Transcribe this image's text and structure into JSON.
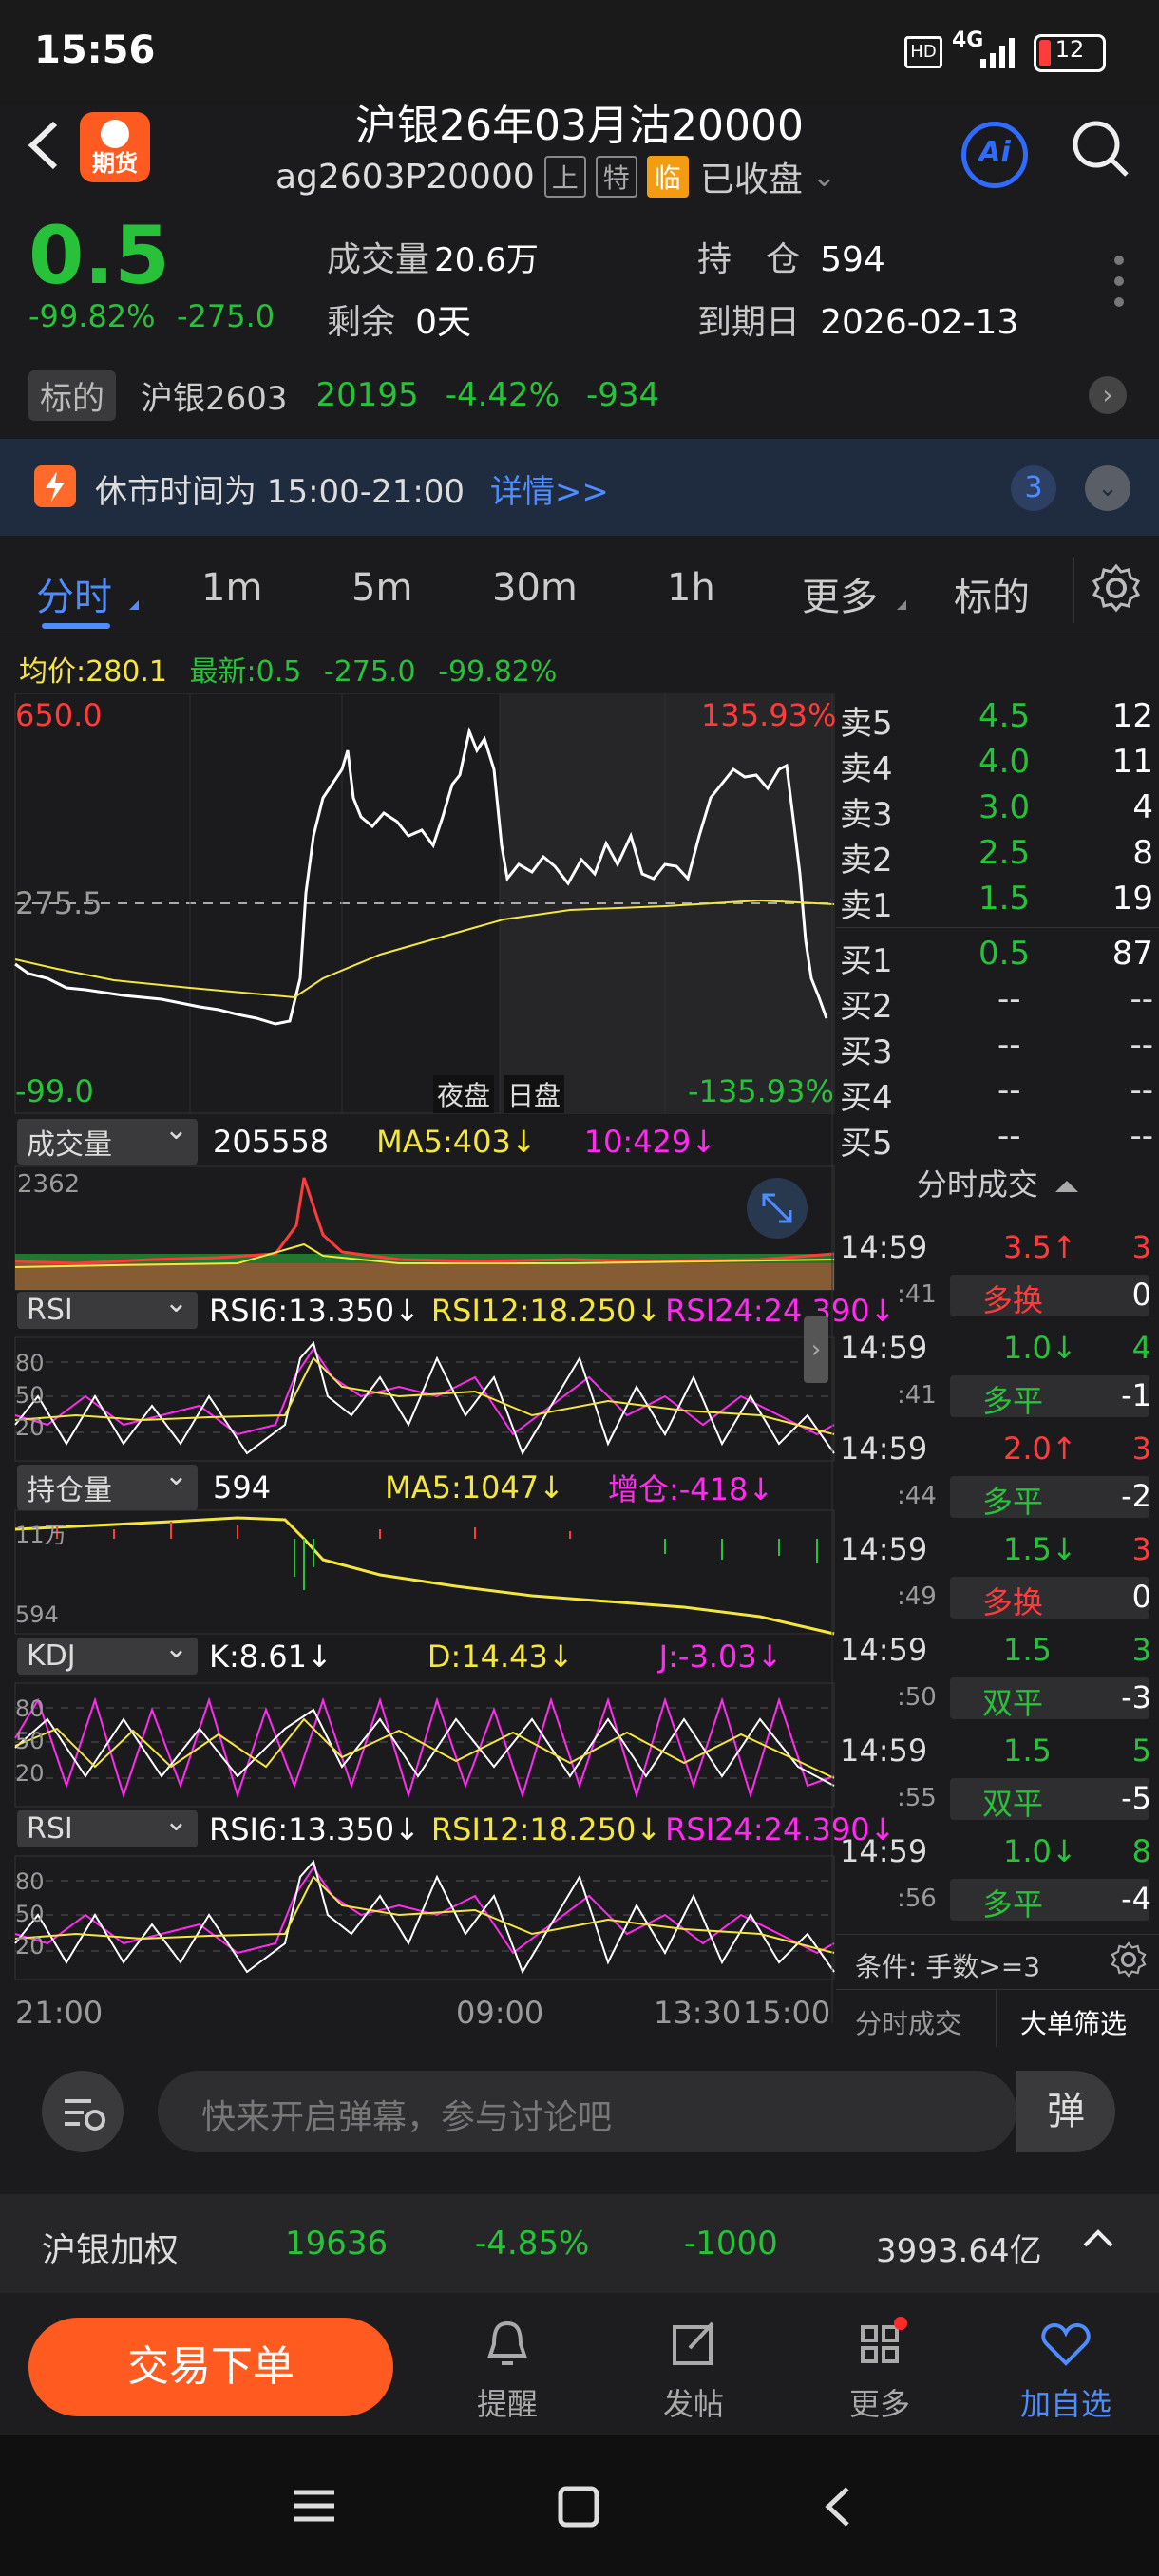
{
  "status": {
    "time": "15:56",
    "hd": "HD",
    "net": "4G",
    "battery": "12"
  },
  "header": {
    "title": "沪银26年03月沽20000",
    "code": "ag2603P20000",
    "tags": [
      "上",
      "特"
    ],
    "tag_lin": "临",
    "state": "已收盘",
    "logo": "期货",
    "ai": "Ai"
  },
  "quote": {
    "price": "0.5",
    "change_pct": "-99.82%",
    "change": "-275.0",
    "volume_label": "成交量",
    "volume": "20.6万",
    "oi_label": "持　仓",
    "oi": "594",
    "remain_label": "剩余",
    "remain": "0天",
    "expire_label": "到期日",
    "expire": "2026-02-13"
  },
  "underlying": {
    "tag": "标的",
    "name": "沪银2603",
    "price": "20195",
    "pct": "-4.42%",
    "chg": "-934"
  },
  "banner": {
    "text": "休市时间为 15:00-21:00",
    "link": "详情>>",
    "count": "3"
  },
  "tabs": [
    {
      "label": "分时"
    },
    {
      "label": "1m"
    },
    {
      "label": "5m"
    },
    {
      "label": "30m"
    },
    {
      "label": "1h"
    },
    {
      "label": "更多"
    },
    {
      "label": "标的"
    }
  ],
  "chart": {
    "avg_label": "均价:280.1",
    "last_label": "最新:0.5",
    "last_chg": "-275.0",
    "last_pct": "-99.82%",
    "top_price": "650.0",
    "top_pct": "135.93%",
    "mid_price": "275.5",
    "bottom_price": "-99.0",
    "bottom_pct": "-135.93%",
    "night": "夜盘",
    "day": "日盘",
    "x_labels": [
      "21:00",
      "09:00",
      "13:30",
      "15:00"
    ]
  },
  "indicators": {
    "vol": {
      "name": "成交量",
      "value": "205558",
      "ma5": "MA5:403↓",
      "ma10": "10:429↓",
      "max": "2362"
    },
    "rsi1": {
      "name": "RSI",
      "r6": "RSI6:13.350↓",
      "r12": "RSI12:18.250↓",
      "r24": "RSI24:24.390↓",
      "levels": [
        "80",
        "50",
        "20"
      ]
    },
    "oi": {
      "name": "持仓量",
      "value": "594",
      "ma5": "MA5:1047↓",
      "inc": "增仓:-418↓",
      "max": "11万",
      "min": "594"
    },
    "kdj": {
      "name": "KDJ",
      "k": "K:8.61↓",
      "d": "D:14.43↓",
      "j": "J:-3.03↓",
      "levels": [
        "80",
        "50",
        "20"
      ]
    },
    "rsi2": {
      "name": "RSI",
      "r6": "RSI6:13.350↓",
      "r12": "RSI12:18.250↓",
      "r24": "RSI24:24.390↓",
      "levels": [
        "80",
        "50",
        "20"
      ]
    }
  },
  "orderbook": {
    "asks": [
      {
        "label": "卖5",
        "price": "4.5",
        "qty": "12"
      },
      {
        "label": "卖4",
        "price": "4.0",
        "qty": "11"
      },
      {
        "label": "卖3",
        "price": "3.0",
        "qty": "4"
      },
      {
        "label": "卖2",
        "price": "2.5",
        "qty": "8"
      },
      {
        "label": "卖1",
        "price": "1.5",
        "qty": "19"
      }
    ],
    "bids": [
      {
        "label": "买1",
        "price": "0.5",
        "qty": "87"
      },
      {
        "label": "买2",
        "price": "--",
        "qty": "--"
      },
      {
        "label": "买3",
        "price": "--",
        "qty": "--"
      },
      {
        "label": "买4",
        "price": "--",
        "qty": "--"
      },
      {
        "label": "买5",
        "price": "--",
        "qty": "--"
      }
    ]
  },
  "trades_title": "分时成交",
  "trades": [
    {
      "time": "14:59",
      "sec": ":41",
      "price": "3.5↑",
      "qty": "3",
      "type": "多换",
      "oi": "0",
      "pc": "red",
      "tc": "red"
    },
    {
      "time": "14:59",
      "sec": ":41",
      "price": "1.0↓",
      "qty": "4",
      "type": "多平",
      "oi": "-1",
      "pc": "green",
      "tc": "green"
    },
    {
      "time": "14:59",
      "sec": ":44",
      "price": "2.0↑",
      "qty": "3",
      "type": "多平",
      "oi": "-2",
      "pc": "red",
      "tc": "green"
    },
    {
      "time": "14:59",
      "sec": ":49",
      "price": "1.5↓",
      "qty": "3",
      "type": "多换",
      "oi": "0",
      "pc": "green",
      "tc": "red"
    },
    {
      "time": "14:59",
      "sec": ":50",
      "price": "1.5",
      "qty": "3",
      "type": "双平",
      "oi": "-3",
      "pc": "green",
      "tc": "green"
    },
    {
      "time": "14:59",
      "sec": ":55",
      "price": "1.5",
      "qty": "5",
      "type": "双平",
      "oi": "-5",
      "pc": "green",
      "tc": "green"
    },
    {
      "time": "14:59",
      "sec": ":56",
      "price": "1.0↓",
      "qty": "8",
      "type": "多平",
      "oi": "-4",
      "pc": "green",
      "tc": "green"
    }
  ],
  "filter": {
    "text": "条件: 手数>=3",
    "tab1": "分时成交",
    "tab2": "大单筛选"
  },
  "danmu": {
    "placeholder": "快来开启弹幕，参与讨论吧",
    "btn": "弹"
  },
  "weighted": {
    "name": "沪银加权",
    "price": "19636",
    "pct": "-4.85%",
    "chg": "-1000",
    "amount": "3993.64亿"
  },
  "bottom": {
    "trade": "交易下单",
    "nav": [
      "提醒",
      "发帖",
      "更多",
      "加自选"
    ]
  },
  "colors": {
    "up": "#ff3b3b",
    "down": "#27c23a",
    "accent": "#4e8cff",
    "orange": "#ff5a1f",
    "avg": "#f4e640"
  }
}
